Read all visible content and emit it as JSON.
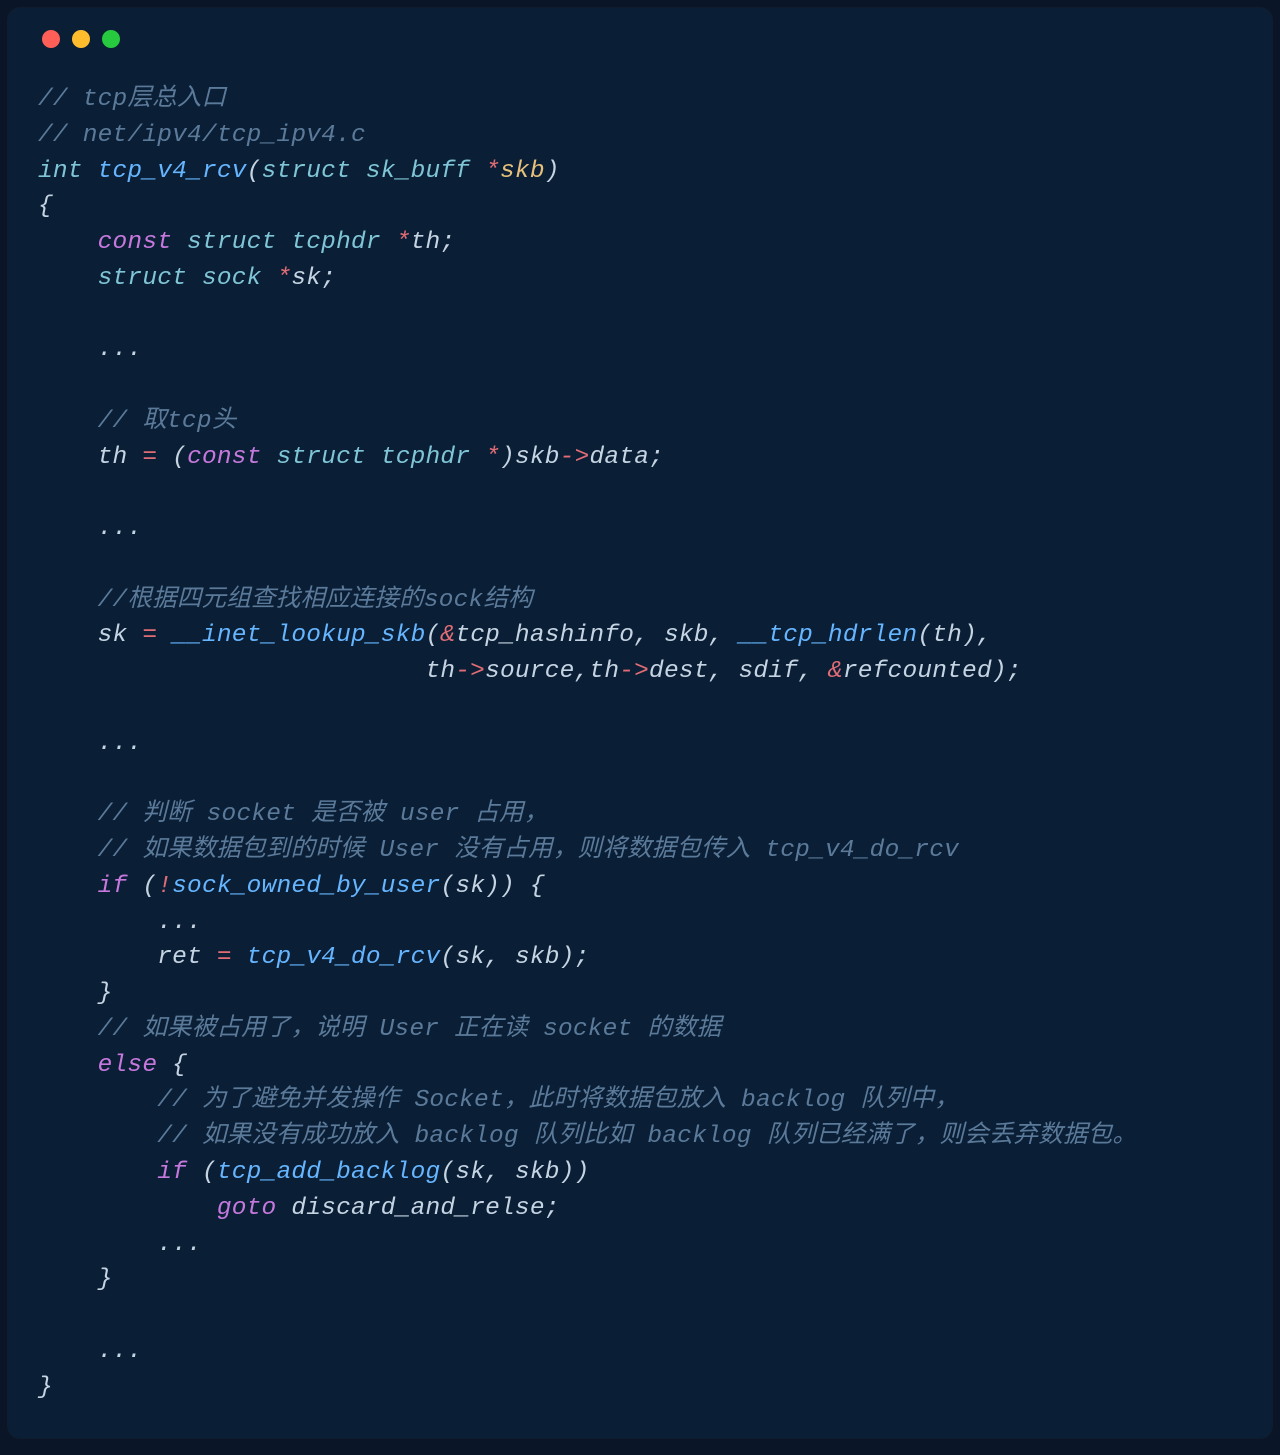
{
  "code": {
    "c1": "// tcp层总入口",
    "c2": "// net/ipv4/tcp_ipv4.c",
    "sig_int": "int",
    "sig_fn": "tcp_v4_rcv",
    "sig_struct": "struct",
    "sig_skbuff": "sk_buff",
    "sig_skb": "skb",
    "l_brace": "{",
    "decl_const": "const",
    "decl_struct1": "struct",
    "decl_tcphdr": "tcphdr",
    "decl_th": "th",
    "decl_struct2": "struct",
    "decl_sock": "sock",
    "decl_sk": "sk",
    "dots1": "...",
    "c3": "// 取tcp头",
    "asn_th": "th",
    "asn_const": "const",
    "asn_struct": "struct",
    "asn_tcphdr": "tcphdr",
    "asn_skb": "skb",
    "asn_data": "data",
    "dots2": "...",
    "c4": "//根据四元组查找相应连接的sock结构",
    "lk_sk": "sk",
    "lk_fn": "__inet_lookup_skb",
    "lk_arg1": "tcp_hashinfo",
    "lk_arg2": "skb",
    "lk_hdrfn": "__tcp_hdrlen",
    "lk_th": "th",
    "lk_th2": "th",
    "lk_source": "source",
    "lk_th3": "th",
    "lk_dest": "dest",
    "lk_sdif": "sdif",
    "lk_ref": "refcounted",
    "dots3": "...",
    "c5": "// 判断 socket 是否被 user 占用，",
    "c6": "// 如果数据包到的时候 User 没有占用，则将数据包传入 tcp_v4_do_rcv",
    "if1": "if",
    "owned_fn": "sock_owned_by_user",
    "owned_sk": "sk",
    "dots4": "...",
    "ret_var": "ret",
    "dorcv_fn": "tcp_v4_do_rcv",
    "dorcv_sk": "sk",
    "dorcv_skb": "skb",
    "r_brace1": "}",
    "c7": "// 如果被占用了，说明 User 正在读 socket 的数据",
    "else1": "else",
    "c8": "// 为了避免并发操作 Socket，此时将数据包放入 backlog 队列中，",
    "c9": "// 如果没有成功放入 backlog 队列比如 backlog 队列已经满了，则会丢弃数据包。",
    "if2": "if",
    "backlog_fn": "tcp_add_backlog",
    "backlog_sk": "sk",
    "backlog_skb": "skb",
    "goto_kw": "goto",
    "goto_label": "discard_and_relse",
    "dots5": "...",
    "r_brace2": "}",
    "dots6": "...",
    "r_brace3": "}",
    "star": "*",
    "amp": "&",
    "arrow": "->",
    "eq": "=",
    "bang": "!",
    "semi": ";",
    "comma": ",",
    "lp": "(",
    "rp": ")",
    "sp_lb": " {"
  }
}
